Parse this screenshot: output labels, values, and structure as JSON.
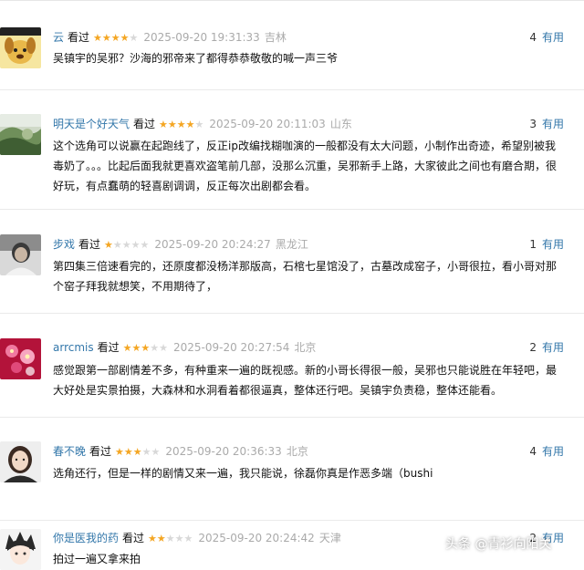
{
  "comments": [
    {
      "user": "云",
      "status": "看过",
      "stars": 4,
      "time": "2025-09-20 19:31:33",
      "location": "吉林",
      "votes": "4",
      "useful_label": "有用",
      "text": "吴镇宇的吴邪？沙海的邪帝来了都得恭恭敬敬的喊一声三爷"
    },
    {
      "user": "明天是个好天气",
      "status": "看过",
      "stars": 4,
      "time": "2025-09-20 20:11:03",
      "location": "山东",
      "votes": "3",
      "useful_label": "有用",
      "text": "这个选角可以说赢在起跑线了，反正ip改编找糊咖演的一般都没有太大问题，小制作出奇迹，希望别被我毒奶了。。。比起后面我就更喜欢盗笔前几部，没那么沉重，吴邪新手上路，大家彼此之间也有磨合期，很好玩，有点蠢萌的轻喜剧调调，反正每次出剧都会看。"
    },
    {
      "user": "步戏",
      "status": "看过",
      "stars": 1,
      "time": "2025-09-20 20:24:27",
      "location": "黑龙江",
      "votes": "1",
      "useful_label": "有用",
      "text": "第四集三倍速看完的，还原度都没杨洋那版高，石棺七星馆没了，古墓改成窑子，小哥很拉，看小哥对那个窑子拜我就想笑，不用期待了，"
    },
    {
      "user": "arrcmis",
      "status": "看过",
      "stars": 3,
      "time": "2025-09-20 20:27:54",
      "location": "北京",
      "votes": "2",
      "useful_label": "有用",
      "text": "感觉跟第一部剧情差不多，有种重来一遍的既视感。新的小哥长得很一般，吴邪也只能说胜在年轻吧，最大好处是实景拍摄，大森林和水洞看着都很逼真，整体还行吧。吴镇宇负责稳，整体还能看。"
    },
    {
      "user": "春不晚",
      "status": "看过",
      "stars": 3,
      "time": "2025-09-20 20:36:33",
      "location": "北京",
      "votes": "4",
      "useful_label": "有用",
      "text": "选角还行，但是一样的剧情又来一遍，我只能说，徐磊你真是作恶多端（bushi"
    },
    {
      "user": "你是医我的药",
      "status": "看过",
      "stars": 2,
      "time": "2025-09-20 20:24:42",
      "location": "天津",
      "votes": "2",
      "useful_label": "有用",
      "text": "拍过一遍又拿来拍"
    }
  ],
  "avatar_icons": [
    "cartoon-dog-avatar-icon",
    "landscape-photo-avatar-icon",
    "portrait-photo-avatar-icon",
    "pink-flowers-avatar-icon",
    "woman-portrait-avatar-icon",
    "anime-character-avatar-icon"
  ],
  "watermark": "头条 @青衫向阳关",
  "colors": {
    "link": "#3377aa",
    "star_on": "#f4a623",
    "star_off": "#d8d8d8",
    "muted": "#aaaaaa"
  }
}
